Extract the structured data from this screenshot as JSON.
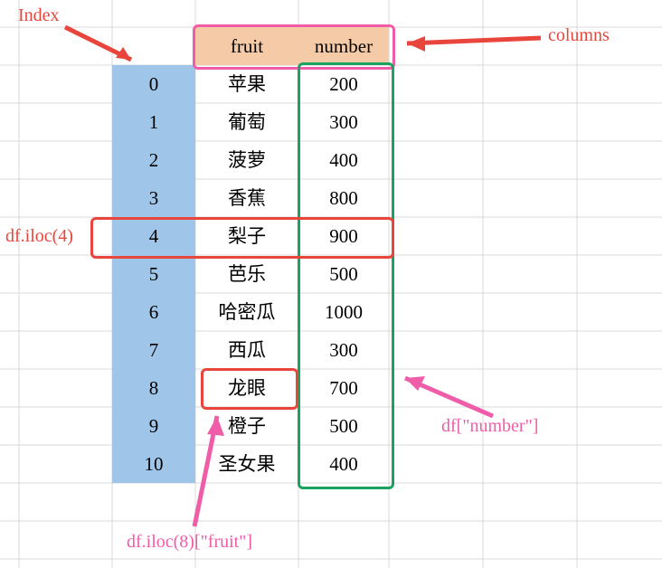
{
  "labels": {
    "index": "Index",
    "columns": "columns",
    "iloc4": "df.iloc(4)",
    "number_col": "df[\"number\"]",
    "iloc8fruit": "df.iloc(8)[\"fruit\"]"
  },
  "headers": {
    "fruit": "fruit",
    "number": "number"
  },
  "rows": [
    {
      "idx": "0",
      "fruit": "苹果",
      "number": "200"
    },
    {
      "idx": "1",
      "fruit": "葡萄",
      "number": "300"
    },
    {
      "idx": "2",
      "fruit": "菠萝",
      "number": "400"
    },
    {
      "idx": "3",
      "fruit": "香蕉",
      "number": "800"
    },
    {
      "idx": "4",
      "fruit": "梨子",
      "number": "900"
    },
    {
      "idx": "5",
      "fruit": "芭乐",
      "number": "500"
    },
    {
      "idx": "6",
      "fruit": "哈密瓜",
      "number": "1000"
    },
    {
      "idx": "7",
      "fruit": "西瓜",
      "number": "300"
    },
    {
      "idx": "8",
      "fruit": "龙眼",
      "number": "700"
    },
    {
      "idx": "9",
      "fruit": "橙子",
      "number": "500"
    },
    {
      "idx": "10",
      "fruit": "圣女果",
      "number": "400"
    }
  ],
  "chart_data": {
    "type": "table",
    "columns": [
      "fruit",
      "number"
    ],
    "index": [
      0,
      1,
      2,
      3,
      4,
      5,
      6,
      7,
      8,
      9,
      10
    ],
    "data": [
      [
        "苹果",
        200
      ],
      [
        "葡萄",
        300
      ],
      [
        "菠萝",
        400
      ],
      [
        "香蕉",
        800
      ],
      [
        "梨子",
        900
      ],
      [
        "芭乐",
        500
      ],
      [
        "哈密瓜",
        1000
      ],
      [
        "西瓜",
        300
      ],
      [
        "龙眼",
        700
      ],
      [
        "橙子",
        500
      ],
      [
        "圣女果",
        400
      ]
    ],
    "annotations": {
      "Index": "row index 0..10",
      "columns": [
        "fruit",
        "number"
      ],
      "df.iloc(4)": {
        "fruit": "梨子",
        "number": 900
      },
      "df[\"number\"]": [
        200,
        300,
        400,
        800,
        900,
        500,
        1000,
        300,
        700,
        500,
        400
      ],
      "df.iloc(8)[\"fruit\"]": "龙眼"
    }
  }
}
